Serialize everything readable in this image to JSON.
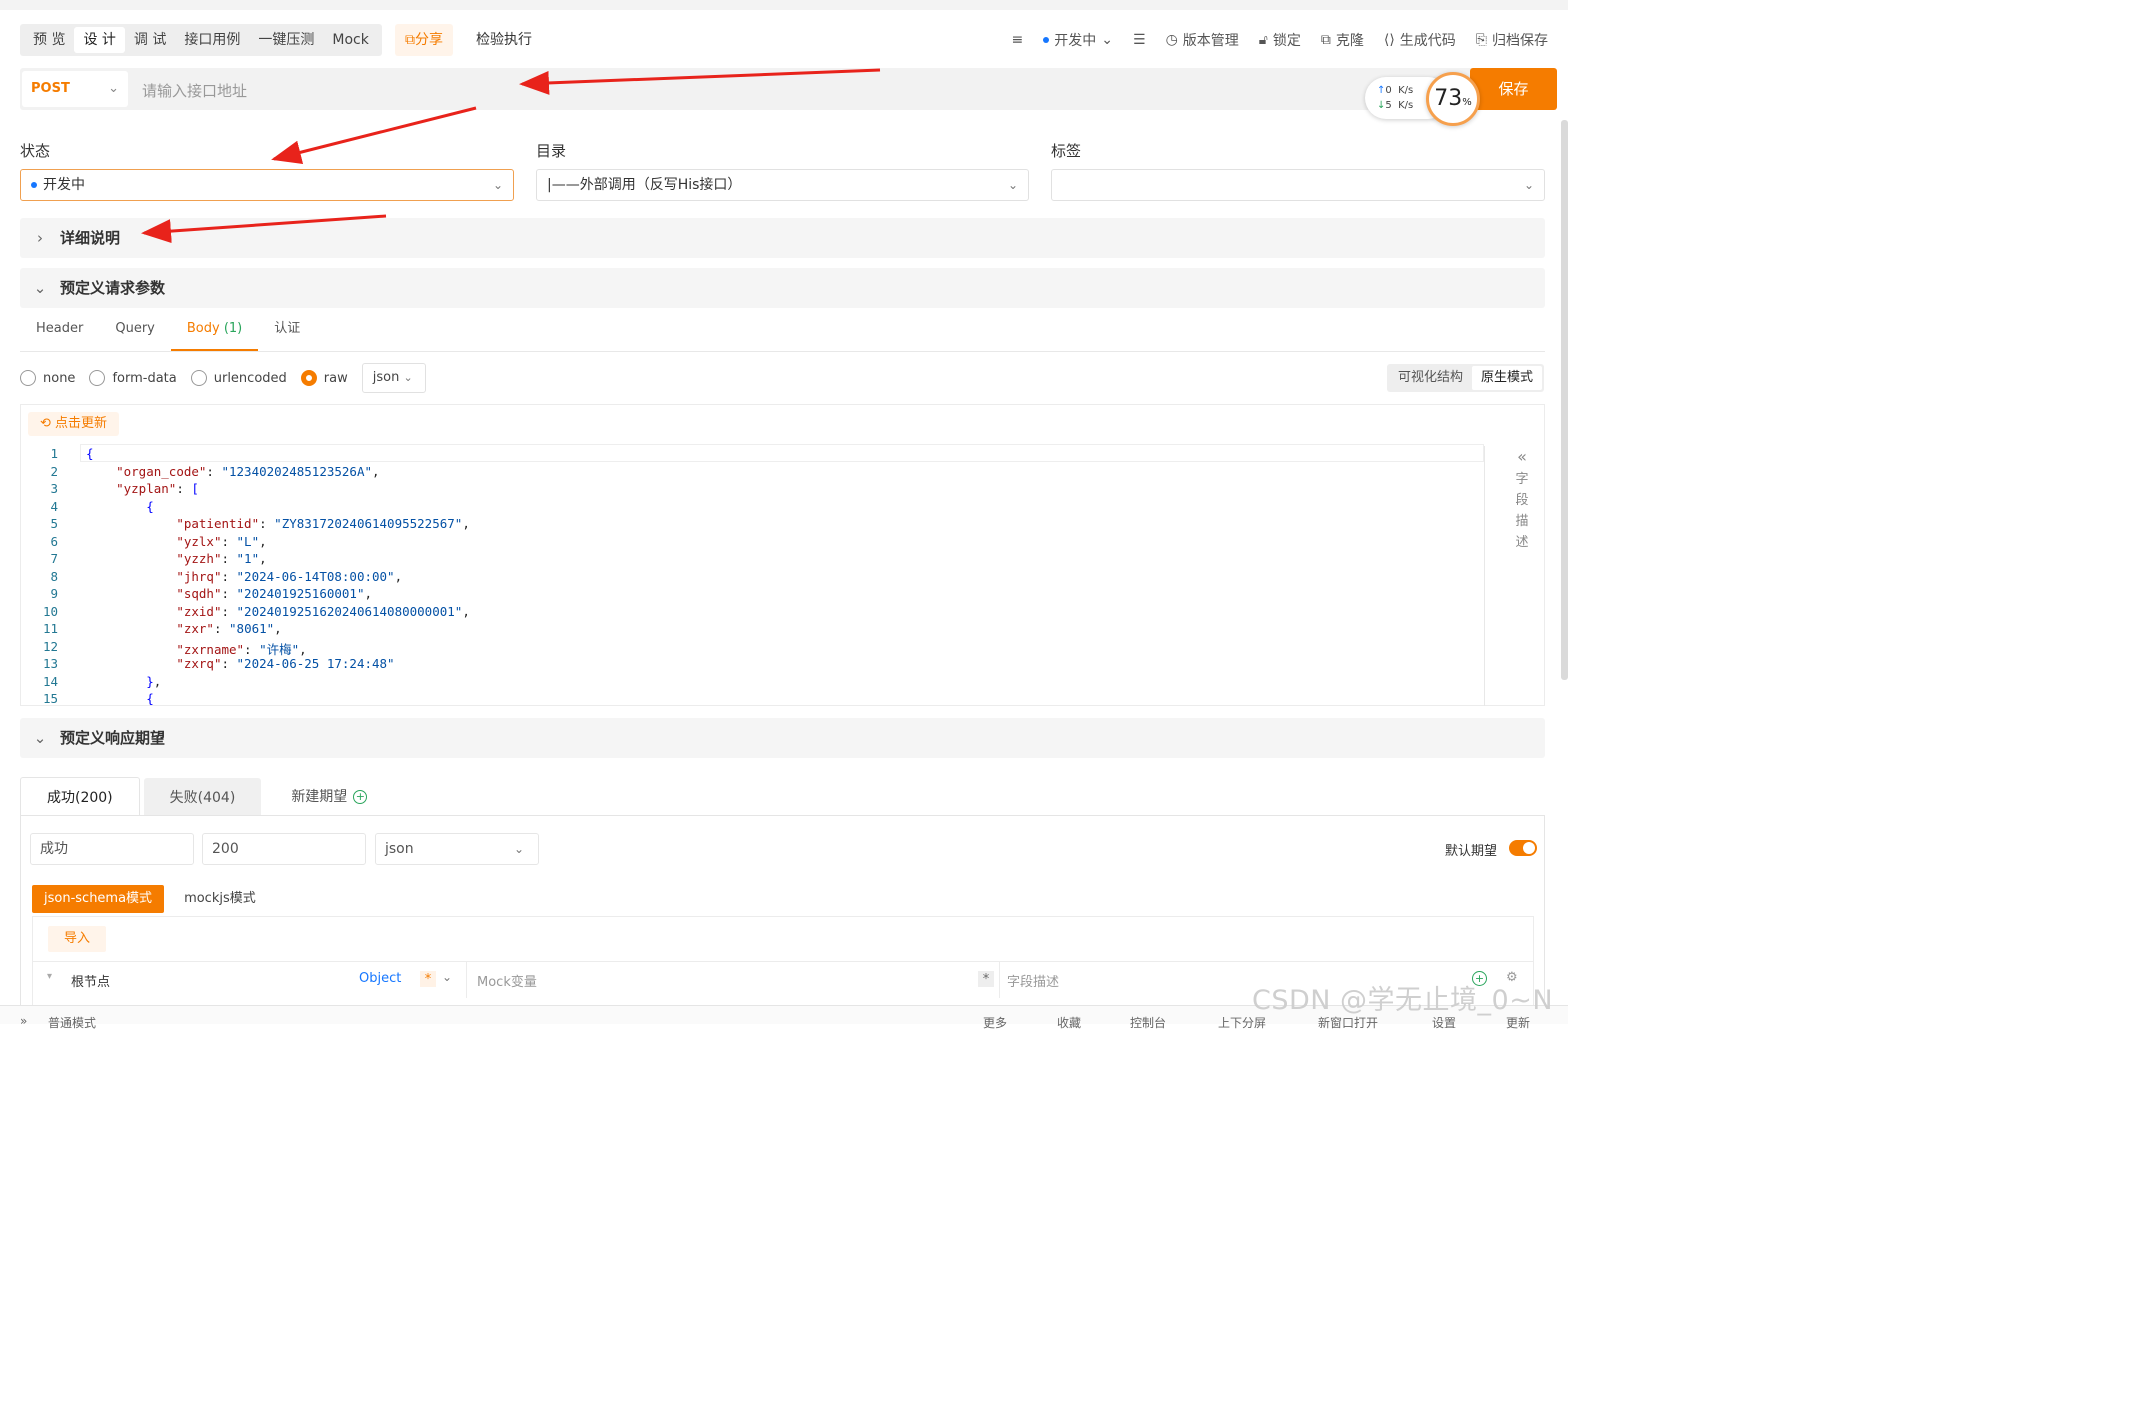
{
  "mode_tabs": [
    "预 览",
    "设 计",
    "调 试",
    "接口用例",
    "一键压测",
    "Mock"
  ],
  "share_label": "分享",
  "run_label": "检验执行",
  "toolbar_right": {
    "status": "开发中",
    "version": "版本管理",
    "lock": "锁定",
    "clone": "克隆",
    "gen_code": "生成代码",
    "archive": "归档保存"
  },
  "request": {
    "method": "POST",
    "url_placeholder": "请输入接口地址",
    "save_label": "保存"
  },
  "network": {
    "up": "0",
    "down": "5",
    "unit": "K/s",
    "cpu": "73",
    "cpu_unit": "%"
  },
  "fields": {
    "status_label": "状态",
    "status_value": "开发中",
    "dir_label": "目录",
    "dir_value": "|——外部调用（反写His接口）",
    "tag_label": "标签"
  },
  "sections": {
    "detail": "详细说明",
    "params": "预定义请求参数",
    "response": "预定义响应期望"
  },
  "param_tabs": {
    "header": "Header",
    "query": "Query",
    "body": "Body",
    "body_count": "(1)",
    "auth": "认证"
  },
  "body_types": {
    "none": "none",
    "form": "form-data",
    "urlenc": "urlencoded",
    "raw": "raw",
    "format": "json"
  },
  "view_modes": {
    "visual": "可视化结构",
    "native": "原生模式"
  },
  "refresh_label": "点击更新",
  "field_desc_chars": [
    "字",
    "段",
    "描",
    "述"
  ],
  "code_lines": [
    {
      "n": "1",
      "t": "{"
    },
    {
      "n": "2",
      "t": "    \"organ_code\": \"12340202485123526A\","
    },
    {
      "n": "3",
      "t": "    \"yzplan\": ["
    },
    {
      "n": "4",
      "t": "        {"
    },
    {
      "n": "5",
      "t": "            \"patientid\": \"ZY831720240614095522567\","
    },
    {
      "n": "6",
      "t": "            \"yzlx\": \"L\","
    },
    {
      "n": "7",
      "t": "            \"yzzh\": \"1\","
    },
    {
      "n": "8",
      "t": "            \"jhrq\": \"2024-06-14T08:00:00\","
    },
    {
      "n": "9",
      "t": "            \"sqdh\": \"202401925160001\","
    },
    {
      "n": "10",
      "t": "            \"zxid\": \"2024019251620240614080000001\","
    },
    {
      "n": "11",
      "t": "            \"zxr\": \"8061\","
    },
    {
      "n": "12",
      "t": "            \"zxrname\": \"许梅\","
    },
    {
      "n": "13",
      "t": "            \"zxrq\": \"2024-06-25 17:24:48\""
    },
    {
      "n": "14",
      "t": "        },"
    },
    {
      "n": "15",
      "t": "        {"
    }
  ],
  "response": {
    "tab_success": "成功(200)",
    "tab_fail": "失败(404)",
    "tab_new": "新建期望",
    "name_value": "成功",
    "code_value": "200",
    "format_value": "json",
    "default_label": "默认期望",
    "schema_tab": "json-schema模式",
    "mock_tab": "mockjs模式",
    "import_label": "导入",
    "root_node": "根节点",
    "root_type": "Object",
    "mock_placeholder": "Mock变量",
    "desc_placeholder": "字段描述"
  },
  "footer": {
    "mode": "普通模式",
    "more": "更多",
    "collect": "收藏",
    "console": "控制台",
    "split": "上下分屏",
    "newwin": "新窗口打开",
    "settings": "设置",
    "update": "更新"
  },
  "watermark": "CSDN @学无止境_0~N",
  "colors": {
    "accent": "#f57c00",
    "annotation_arrow": "#e8231b",
    "status_dot": "#1677ff"
  }
}
